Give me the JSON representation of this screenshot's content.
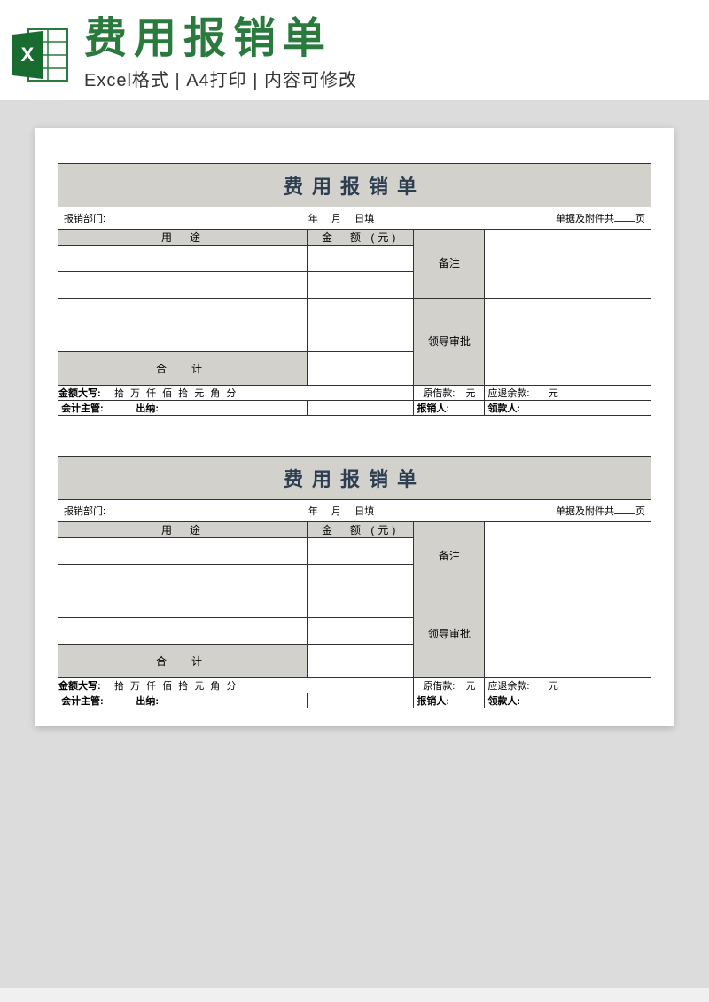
{
  "header": {
    "main_title": "费用报销单",
    "subtitle": "Excel格式 | A4打印 | 内容可修改",
    "icon_label": "excel-icon"
  },
  "form": {
    "title": "费用报销单",
    "dept_label": "报销部门:",
    "date_year": "年",
    "date_month": "月",
    "date_day": "日填",
    "attachments_label": "单据及附件共",
    "attachments_unit": "页",
    "col_purpose": "用　途",
    "col_amount": "金　额 (元)",
    "side_remark": "备注",
    "side_approval": "领导审批",
    "total_label": "合　计",
    "amount_words_label": "金额大写:",
    "amount_units": "拾 万 仟 佰 拾 元 角 分",
    "loan_label": "原借款:",
    "loan_unit": "元",
    "refund_label": "应退余款:",
    "refund_unit": "元",
    "sig_supervisor": "会计主管:",
    "sig_cashier": "出纳:",
    "sig_applicant": "报销人:",
    "sig_payee": "领款人:"
  }
}
